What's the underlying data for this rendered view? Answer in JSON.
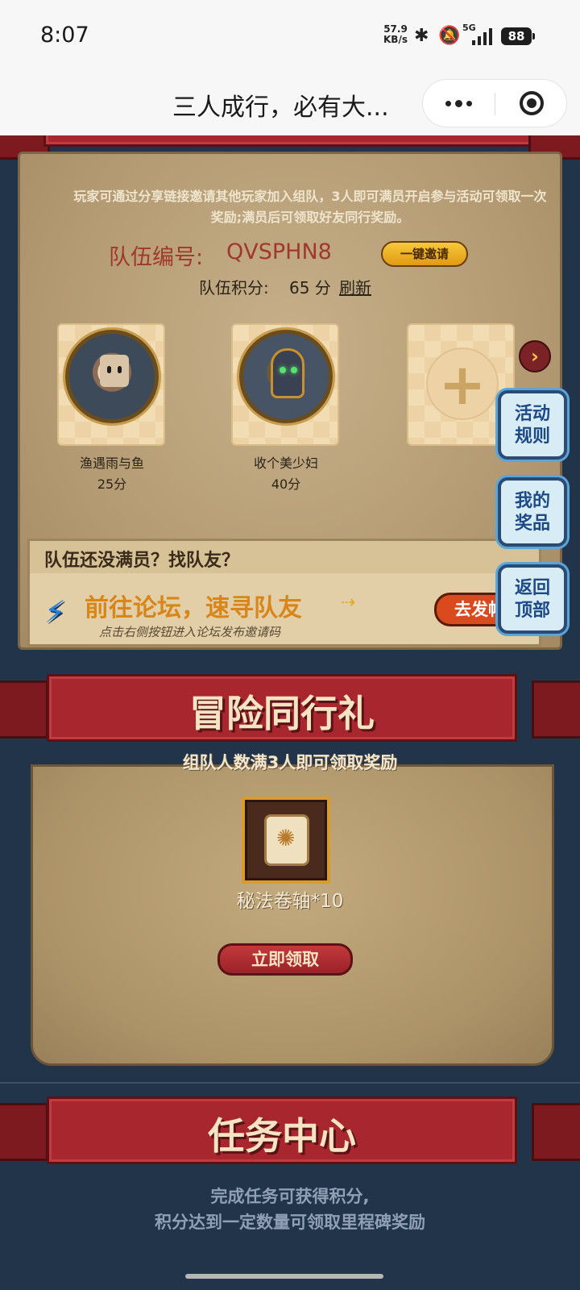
{
  "status_bar": {
    "time": "8:07",
    "net_speed_value": "57.9",
    "net_speed_unit": "KB/s",
    "network_label": "5G",
    "battery": "88",
    "icons": [
      "bluetooth-icon",
      "mute-icon",
      "signal-icon",
      "battery-icon"
    ]
  },
  "mini_program": {
    "title": "三人成行，必有大...",
    "more_icon": "more-dots-icon",
    "close_icon": "close-circle-icon"
  },
  "team": {
    "description": "玩家可通过分享链接邀请其他玩家加入组队，3人即可满员开启参与活动可领取一次奖励;满员后可领取好友同行奖励。",
    "id_label": "队伍编号:",
    "id_value": "QVSPHN8",
    "invite_button": "一键邀请",
    "score_label": "队伍积分:",
    "score_value": "65 分",
    "refresh_link": "刷新",
    "members": [
      {
        "name": "渔遇雨与鱼",
        "score": "25分"
      },
      {
        "name": "收个美少妇",
        "score": "40分"
      }
    ],
    "empty_slot_icon": "plus-icon",
    "next_icon": "chevron-right-icon"
  },
  "recruit": {
    "title": "队伍还没满员？找队友？",
    "cta": "前往论坛，速寻队友",
    "subtitle": "点击右侧按钮进入论坛发布邀请码",
    "button": "去发帖"
  },
  "side_buttons": [
    {
      "label": "活动\n规则"
    },
    {
      "label": "我的\n奖品"
    },
    {
      "label": "返回\n顶部"
    }
  ],
  "reward": {
    "title": "冒险同行礼",
    "subtitle": "组队人数满3人即可领取奖励",
    "item_name": "秘法卷轴*10",
    "claim_button": "立即领取"
  },
  "tasks": {
    "title": "任务中心",
    "desc_line1": "完成任务可获得积分,",
    "desc_line2": "积分达到一定数量可领取里程碑奖励"
  },
  "colors": {
    "page_bg": "#21344a",
    "ribbon_red": "#a8262e",
    "parchment": "#b9a27c",
    "team_id_red": "#a0382d",
    "cta_orange": "#d8851a",
    "side_button_blue": "#1d4a86"
  }
}
